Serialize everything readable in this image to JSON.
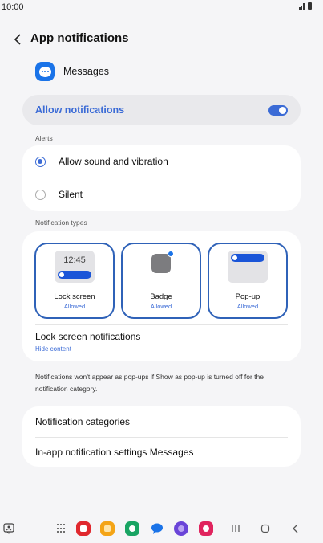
{
  "status_bar": {
    "time": "10:00"
  },
  "header": {
    "title": "App notifications"
  },
  "app": {
    "name": "Messages",
    "icon": "messages-bubble-icon",
    "icon_color": "#1a73e8"
  },
  "allow_notifications": {
    "label": "Allow notifications",
    "enabled": true,
    "accent": "#3b6bd6"
  },
  "alerts": {
    "section_label": "Alerts",
    "options": [
      {
        "label": "Allow sound and vibration",
        "selected": true
      },
      {
        "label": "Silent",
        "selected": false
      }
    ]
  },
  "notification_types": {
    "section_label": "Notification types",
    "tiles": [
      {
        "name": "Lock screen",
        "status": "Allowed",
        "preview_time": "12:45"
      },
      {
        "name": "Badge",
        "status": "Allowed"
      },
      {
        "name": "Pop-up",
        "status": "Allowed"
      }
    ],
    "lock_screen": {
      "title": "Lock screen notifications",
      "value": "Hide content"
    }
  },
  "note": "Notifications won't appear as pop-ups if Show as pop-up is turned off for the notification category.",
  "more": {
    "items": [
      {
        "label": "Notification categories"
      },
      {
        "label": "In-app notification settings Messages"
      }
    ]
  },
  "nav_bar": {
    "icons": [
      "accessibility-icon",
      "app-drawer-icon",
      "flipboard-icon",
      "my-files-icon",
      "phone-icon",
      "messages-icon",
      "internet-icon",
      "gallery-icon",
      "recents-icon",
      "home-icon",
      "back-icon"
    ]
  }
}
